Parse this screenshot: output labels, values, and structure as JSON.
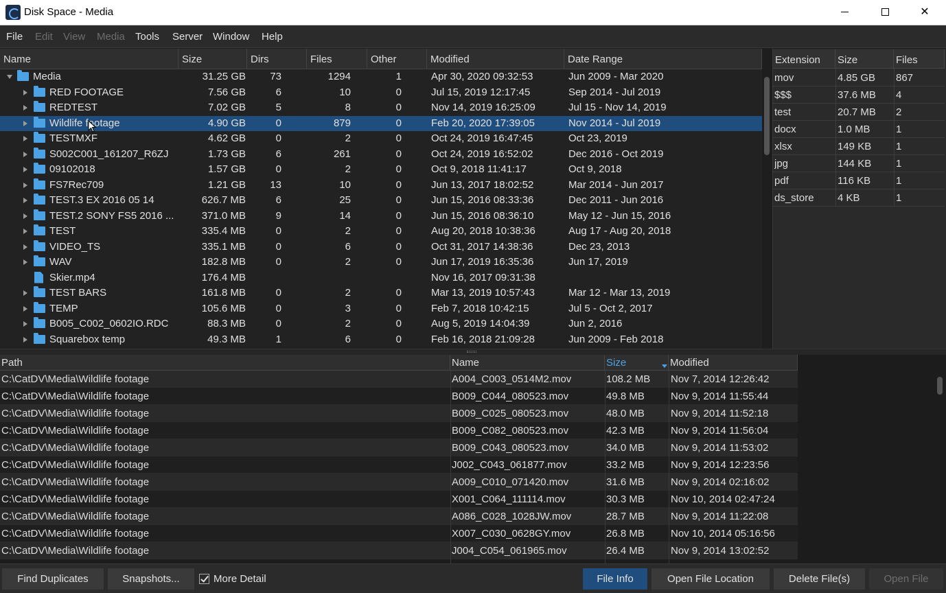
{
  "window": {
    "title": "Disk Space - Media"
  },
  "menu": [
    {
      "label": "File",
      "enabled": true
    },
    {
      "label": "Edit",
      "enabled": false
    },
    {
      "label": "View",
      "enabled": false
    },
    {
      "label": "Media",
      "enabled": false
    },
    {
      "label": "Tools",
      "enabled": true
    },
    {
      "label": "Server",
      "enabled": true
    },
    {
      "label": "Window",
      "enabled": true
    },
    {
      "label": "Help",
      "enabled": true
    }
  ],
  "tree": {
    "headers": {
      "name": "Name",
      "size": "Size",
      "dirs": "Dirs",
      "files": "Files",
      "other": "Other",
      "modified": "Modified",
      "range": "Date Range"
    },
    "rows": [
      {
        "name": "Media",
        "size": "31.25 GB",
        "dirs": "73",
        "files": "1294",
        "other": "1",
        "modified": "Apr 30, 2020 09:32:53",
        "range": "Jun 2009 - Mar 2020",
        "type": "folder",
        "level": 0,
        "expanded": true
      },
      {
        "name": "RED FOOTAGE",
        "size": "7.56 GB",
        "dirs": "6",
        "files": "10",
        "other": "0",
        "modified": "Jul 15, 2019 12:17:45",
        "range": "Sep 2014 - Jul 2019",
        "type": "folder",
        "level": 1
      },
      {
        "name": "REDTEST",
        "size": "7.02 GB",
        "dirs": "5",
        "files": "8",
        "other": "0",
        "modified": "Nov 14, 2019 16:25:09",
        "range": "Jul 15 - Nov 14, 2019",
        "type": "folder",
        "level": 1
      },
      {
        "name": "Wildlife footage",
        "size": "4.90 GB",
        "dirs": "0",
        "files": "879",
        "other": "0",
        "modified": "Feb 20, 2020 17:39:05",
        "range": "Nov 2014 - Jul 2019",
        "type": "folder",
        "level": 1,
        "selected": true
      },
      {
        "name": "TESTMXF",
        "size": "4.62 GB",
        "dirs": "0",
        "files": "2",
        "other": "0",
        "modified": "Oct 24, 2019 16:47:45",
        "range": "Oct 23, 2019",
        "type": "folder",
        "level": 1
      },
      {
        "name": "S002C001_161207_R6ZJ",
        "size": "1.73 GB",
        "dirs": "6",
        "files": "261",
        "other": "0",
        "modified": "Oct 24, 2019 16:52:02",
        "range": "Dec 2016 - Oct 2019",
        "type": "folder",
        "level": 1
      },
      {
        "name": "09102018",
        "size": "1.57 GB",
        "dirs": "0",
        "files": "2",
        "other": "0",
        "modified": "Oct 9, 2018 11:41:17",
        "range": "Oct 9, 2018",
        "type": "folder",
        "level": 1
      },
      {
        "name": "FS7Rec709",
        "size": "1.21 GB",
        "dirs": "13",
        "files": "10",
        "other": "0",
        "modified": "Jun 13, 2017 18:02:52",
        "range": "Mar 2014 - Jun 2017",
        "type": "folder",
        "level": 1
      },
      {
        "name": "TEST.3 EX 2016 05 14",
        "size": "626.7 MB",
        "dirs": "6",
        "files": "25",
        "other": "0",
        "modified": "Jun 15, 2016 08:33:36",
        "range": "Dec 2011 - Jun 2016",
        "type": "folder",
        "level": 1
      },
      {
        "name": "TEST.2 SONY FS5 2016 ...",
        "size": "371.0 MB",
        "dirs": "9",
        "files": "14",
        "other": "0",
        "modified": "Jun 15, 2016 08:36:10",
        "range": "May 12 - Jun 15, 2016",
        "type": "folder",
        "level": 1
      },
      {
        "name": "TEST",
        "size": "335.4 MB",
        "dirs": "0",
        "files": "2",
        "other": "0",
        "modified": "Aug 20, 2018 10:38:36",
        "range": "Aug 17 - Aug 20, 2018",
        "type": "folder",
        "level": 1
      },
      {
        "name": "VIDEO_TS",
        "size": "335.1 MB",
        "dirs": "0",
        "files": "6",
        "other": "0",
        "modified": "Oct 31, 2017 14:38:36",
        "range": "Dec 23, 2013",
        "type": "folder",
        "level": 1
      },
      {
        "name": "WAV",
        "size": "182.8 MB",
        "dirs": "0",
        "files": "2",
        "other": "0",
        "modified": "Jun 17, 2019 16:35:36",
        "range": "Jun 17, 2019",
        "type": "folder",
        "level": 1
      },
      {
        "name": "Skier.mp4",
        "size": "176.4 MB",
        "dirs": "",
        "files": "",
        "other": "",
        "modified": "Nov 16, 2017 09:31:38",
        "range": "",
        "type": "file",
        "level": 1
      },
      {
        "name": "TEST BARS",
        "size": "161.8 MB",
        "dirs": "0",
        "files": "2",
        "other": "0",
        "modified": "Mar 13, 2019 10:57:43",
        "range": "Mar 12 - Mar 13, 2019",
        "type": "folder",
        "level": 1
      },
      {
        "name": "TEMP",
        "size": "105.6 MB",
        "dirs": "0",
        "files": "3",
        "other": "0",
        "modified": "Feb 7, 2018 10:42:15",
        "range": "Jul 5 - Oct 2, 2017",
        "type": "folder",
        "level": 1
      },
      {
        "name": "B005_C002_0602IO.RDC",
        "size": "88.3 MB",
        "dirs": "0",
        "files": "2",
        "other": "0",
        "modified": "Aug 5, 2019 14:04:39",
        "range": "Jun 2, 2016",
        "type": "folder",
        "level": 1
      },
      {
        "name": "Squarebox temp",
        "size": "49.3 MB",
        "dirs": "1",
        "files": "6",
        "other": "0",
        "modified": "Feb 16, 2018 21:09:28",
        "range": "Jun 2009 - Feb 2018",
        "type": "folder",
        "level": 1
      }
    ]
  },
  "extensions": {
    "headers": {
      "ext": "Extension",
      "size": "Size",
      "files": "Files"
    },
    "rows": [
      {
        "ext": "mov",
        "size": "4.85 GB",
        "files": "867"
      },
      {
        "ext": "$$$",
        "size": "37.6 MB",
        "files": "4"
      },
      {
        "ext": "test",
        "size": "20.7 MB",
        "files": "2"
      },
      {
        "ext": "docx",
        "size": "1.0 MB",
        "files": "1"
      },
      {
        "ext": "xlsx",
        "size": "149 KB",
        "files": "1"
      },
      {
        "ext": "jpg",
        "size": "144 KB",
        "files": "1"
      },
      {
        "ext": "pdf",
        "size": "116 KB",
        "files": "1"
      },
      {
        "ext": "ds_store",
        "size": "4 KB",
        "files": "1"
      }
    ]
  },
  "files": {
    "headers": {
      "path": "Path",
      "name": "Name",
      "size": "Size",
      "modified": "Modified"
    },
    "sorted_by": "Size",
    "rows": [
      {
        "path": "C:\\CatDV\\Media\\Wildlife footage",
        "name": "A004_C003_0514M2.mov",
        "size": "108.2 MB",
        "modified": "Nov 7, 2014 12:26:42"
      },
      {
        "path": "C:\\CatDV\\Media\\Wildlife footage",
        "name": "B009_C044_080523.mov",
        "size": "49.8 MB",
        "modified": "Nov 9, 2014 11:55:44"
      },
      {
        "path": "C:\\CatDV\\Media\\Wildlife footage",
        "name": "B009_C025_080523.mov",
        "size": "48.0 MB",
        "modified": "Nov 9, 2014 11:52:18"
      },
      {
        "path": "C:\\CatDV\\Media\\Wildlife footage",
        "name": "B009_C082_080523.mov",
        "size": "42.3 MB",
        "modified": "Nov 9, 2014 11:56:04"
      },
      {
        "path": "C:\\CatDV\\Media\\Wildlife footage",
        "name": "B009_C043_080523.mov",
        "size": "34.0 MB",
        "modified": "Nov 9, 2014 11:53:02"
      },
      {
        "path": "C:\\CatDV\\Media\\Wildlife footage",
        "name": "J002_C043_061877.mov",
        "size": "33.2 MB",
        "modified": "Nov 9, 2014 12:23:56"
      },
      {
        "path": "C:\\CatDV\\Media\\Wildlife footage",
        "name": "A009_C010_071420.mov",
        "size": "31.6 MB",
        "modified": "Nov 9, 2014 02:16:02"
      },
      {
        "path": "C:\\CatDV\\Media\\Wildlife footage",
        "name": "X001_C064_111114.mov",
        "size": "30.3 MB",
        "modified": "Nov 10, 2014 02:47:24"
      },
      {
        "path": "C:\\CatDV\\Media\\Wildlife footage",
        "name": "A086_C028_1028JW.mov",
        "size": "28.7 MB",
        "modified": "Nov 9, 2014 11:22:08"
      },
      {
        "path": "C:\\CatDV\\Media\\Wildlife footage",
        "name": "X007_C030_0628GY.mov",
        "size": "26.8 MB",
        "modified": "Nov 10, 2014 05:16:56"
      },
      {
        "path": "C:\\CatDV\\Media\\Wildlife footage",
        "name": "J004_C054_061965.mov",
        "size": "26.4 MB",
        "modified": "Nov 9, 2014 13:02:52"
      }
    ]
  },
  "toolbar": {
    "find_duplicates": "Find Duplicates",
    "snapshots": "Snapshots...",
    "more_detail": "More Detail",
    "more_detail_checked": true,
    "file_info": "File Info",
    "open_location": "Open File Location",
    "delete_files": "Delete File(s)",
    "open_file": "Open File"
  }
}
